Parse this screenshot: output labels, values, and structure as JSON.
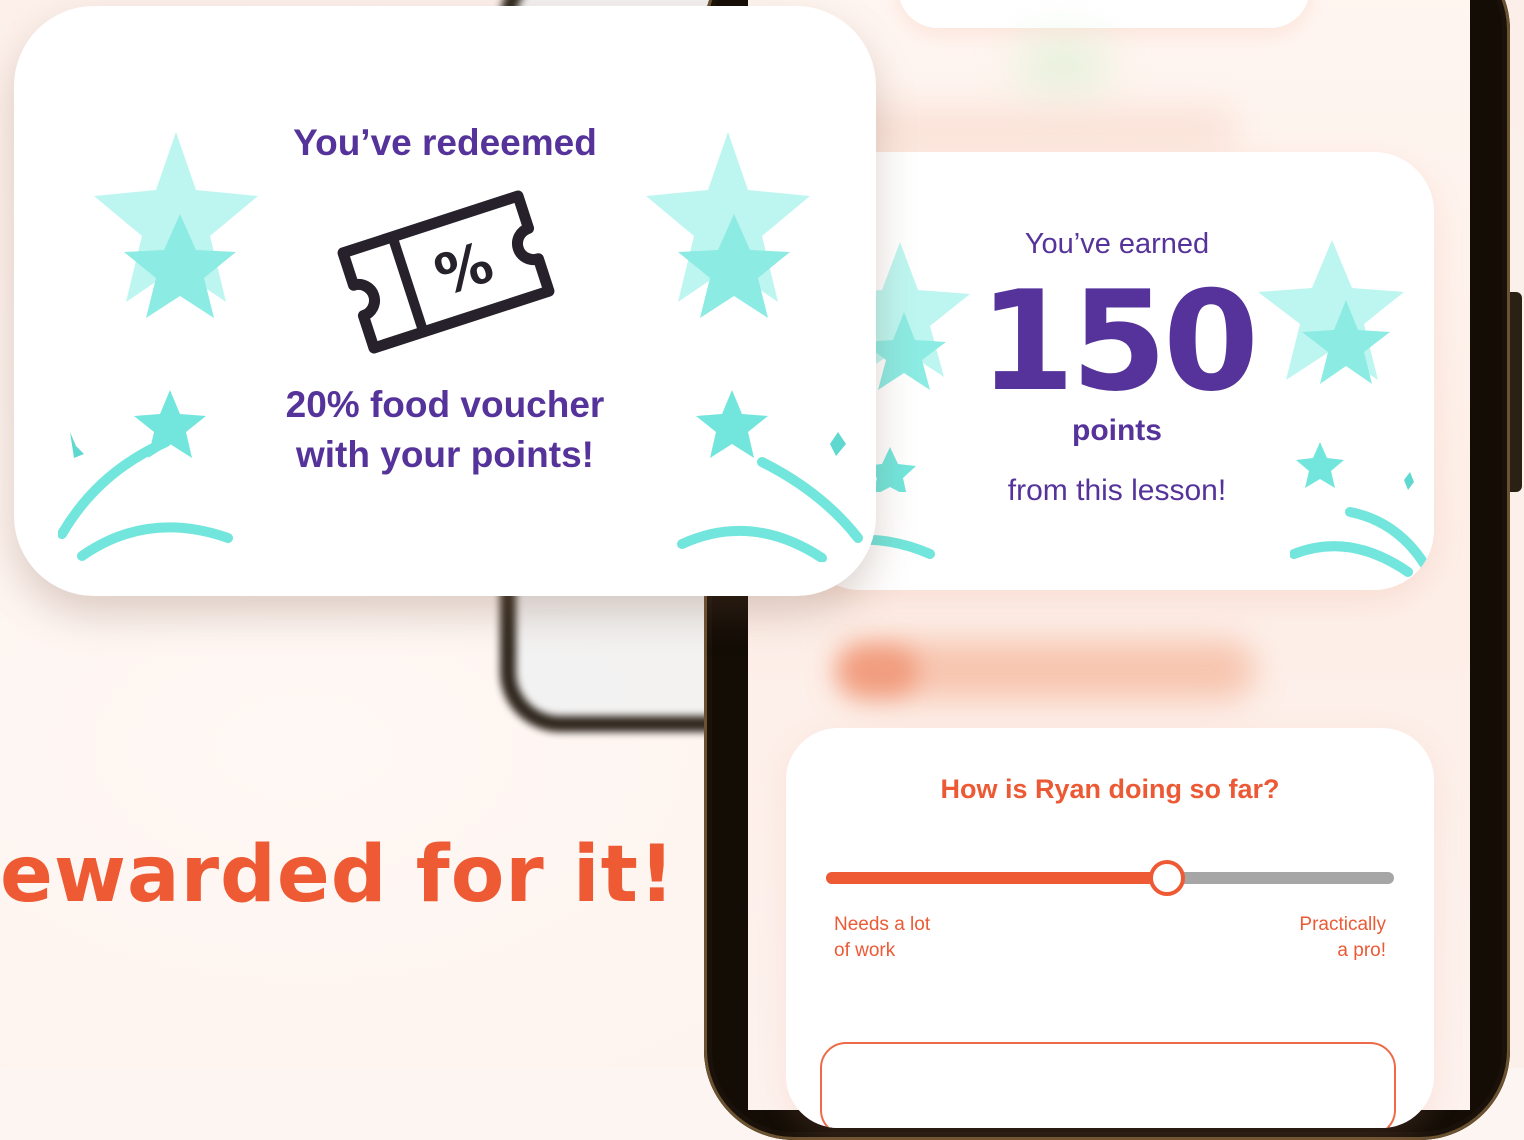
{
  "headline": "ewarded for it!",
  "redeem": {
    "title": "You’ve redeemed",
    "percent": "%",
    "line1": "20% food voucher",
    "line2": "with your points!"
  },
  "earned": {
    "title": "You’ve earned",
    "points": "150",
    "unit": "points",
    "subtitle": "from this lesson!"
  },
  "rating": {
    "question": "How is Ryan doing so far?",
    "slider_value": 0.6,
    "left_label_1": "Needs a lot",
    "left_label_2": "of work",
    "right_label_1": "Practically",
    "right_label_2": "a pro!"
  },
  "colors": {
    "accent": "#ee5a33",
    "purple": "#55339a",
    "mint": "#72e6dc",
    "mint_light": "#bdf6f0"
  }
}
